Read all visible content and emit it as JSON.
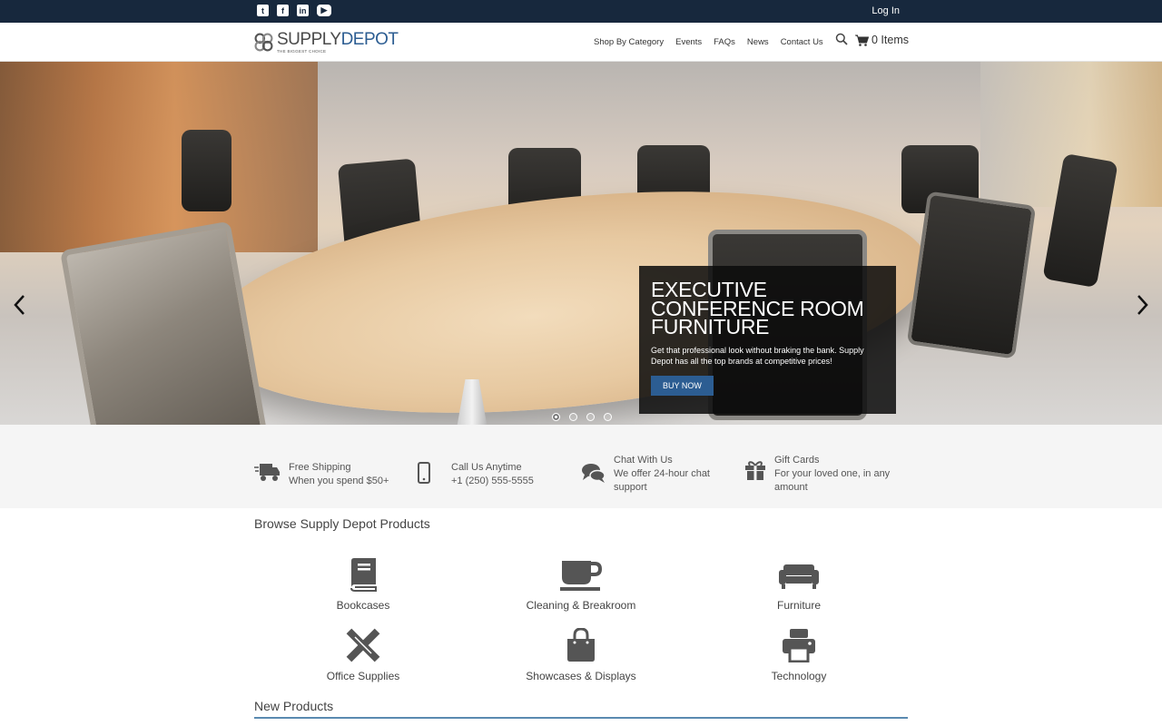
{
  "topbar": {
    "social_icons": [
      "twitter-icon",
      "facebook-icon",
      "linkedin-icon",
      "youtube-icon"
    ],
    "login_label": "Log In"
  },
  "header": {
    "logo_supply": "SUPPLY",
    "logo_depot": "DEPOT",
    "logo_tagline": "THE BIGGEST CHOICE",
    "nav": [
      "Shop By Category",
      "Events",
      "FAQs",
      "News",
      "Contact Us"
    ],
    "cart_label": "0 Items"
  },
  "hero": {
    "title": "EXECUTIVE CONFERENCE ROOM FURNITURE",
    "text": "Get that professional look without braking the bank. Supply Depot has all the top brands at competitive prices!",
    "button_label": "BUY NOW",
    "slide_count": 4,
    "active_slide": 1
  },
  "features": [
    {
      "icon": "truck-icon",
      "title": "Free Shipping",
      "text": "When you spend $50+"
    },
    {
      "icon": "phone-icon",
      "title": "Call Us Anytime",
      "text": "+1 (250) 555-5555"
    },
    {
      "icon": "chat-icon",
      "title": "Chat With Us",
      "text": "We offer 24-hour chat support"
    },
    {
      "icon": "gift-icon",
      "title": "Gift Cards",
      "text": "For your loved one, in any amount"
    }
  ],
  "browse": {
    "title": "Browse Supply Depot Products",
    "categories": [
      {
        "icon": "book-icon",
        "label": "Bookcases"
      },
      {
        "icon": "coffee-icon",
        "label": "Cleaning & Breakroom"
      },
      {
        "icon": "sofa-icon",
        "label": "Furniture"
      },
      {
        "icon": "pencil-ruler-icon",
        "label": "Office Supplies"
      },
      {
        "icon": "shopping-bag-icon",
        "label": "Showcases & Displays"
      },
      {
        "icon": "printer-icon",
        "label": "Technology"
      }
    ]
  },
  "new_products": {
    "title": "New Products"
  },
  "colors": {
    "topbar": "#17283d",
    "accent": "#2c5d92",
    "features_bg": "#f5f5f5",
    "icon_gray": "#555555"
  }
}
